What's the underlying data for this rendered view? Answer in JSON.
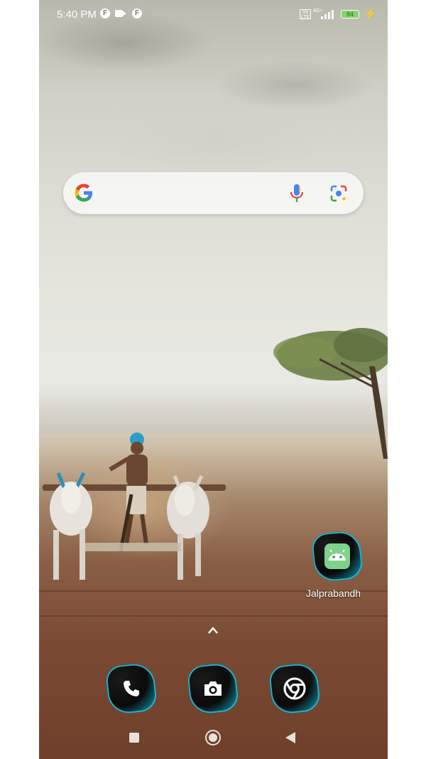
{
  "status_bar": {
    "time": "5:40 PM",
    "notification_icons": [
      "f-icon",
      "video-icon",
      "f-icon"
    ],
    "volte": "Vo LTE",
    "network": "4G+",
    "battery": "84"
  },
  "search_widget": {
    "icons": [
      "google-logo-icon",
      "mic-icon",
      "lens-icon"
    ]
  },
  "home_apps": [
    {
      "label": "Jalprabandh",
      "icon": "android-icon"
    }
  ],
  "dock": {
    "apps": [
      "phone-icon",
      "camera-icon",
      "chrome-icon"
    ]
  },
  "nav_bar": {
    "buttons": [
      "recents-button",
      "home-button",
      "back-button"
    ]
  },
  "colors": {
    "icon_accent": "#19b6d2",
    "battery_fill": "#86d36b"
  }
}
